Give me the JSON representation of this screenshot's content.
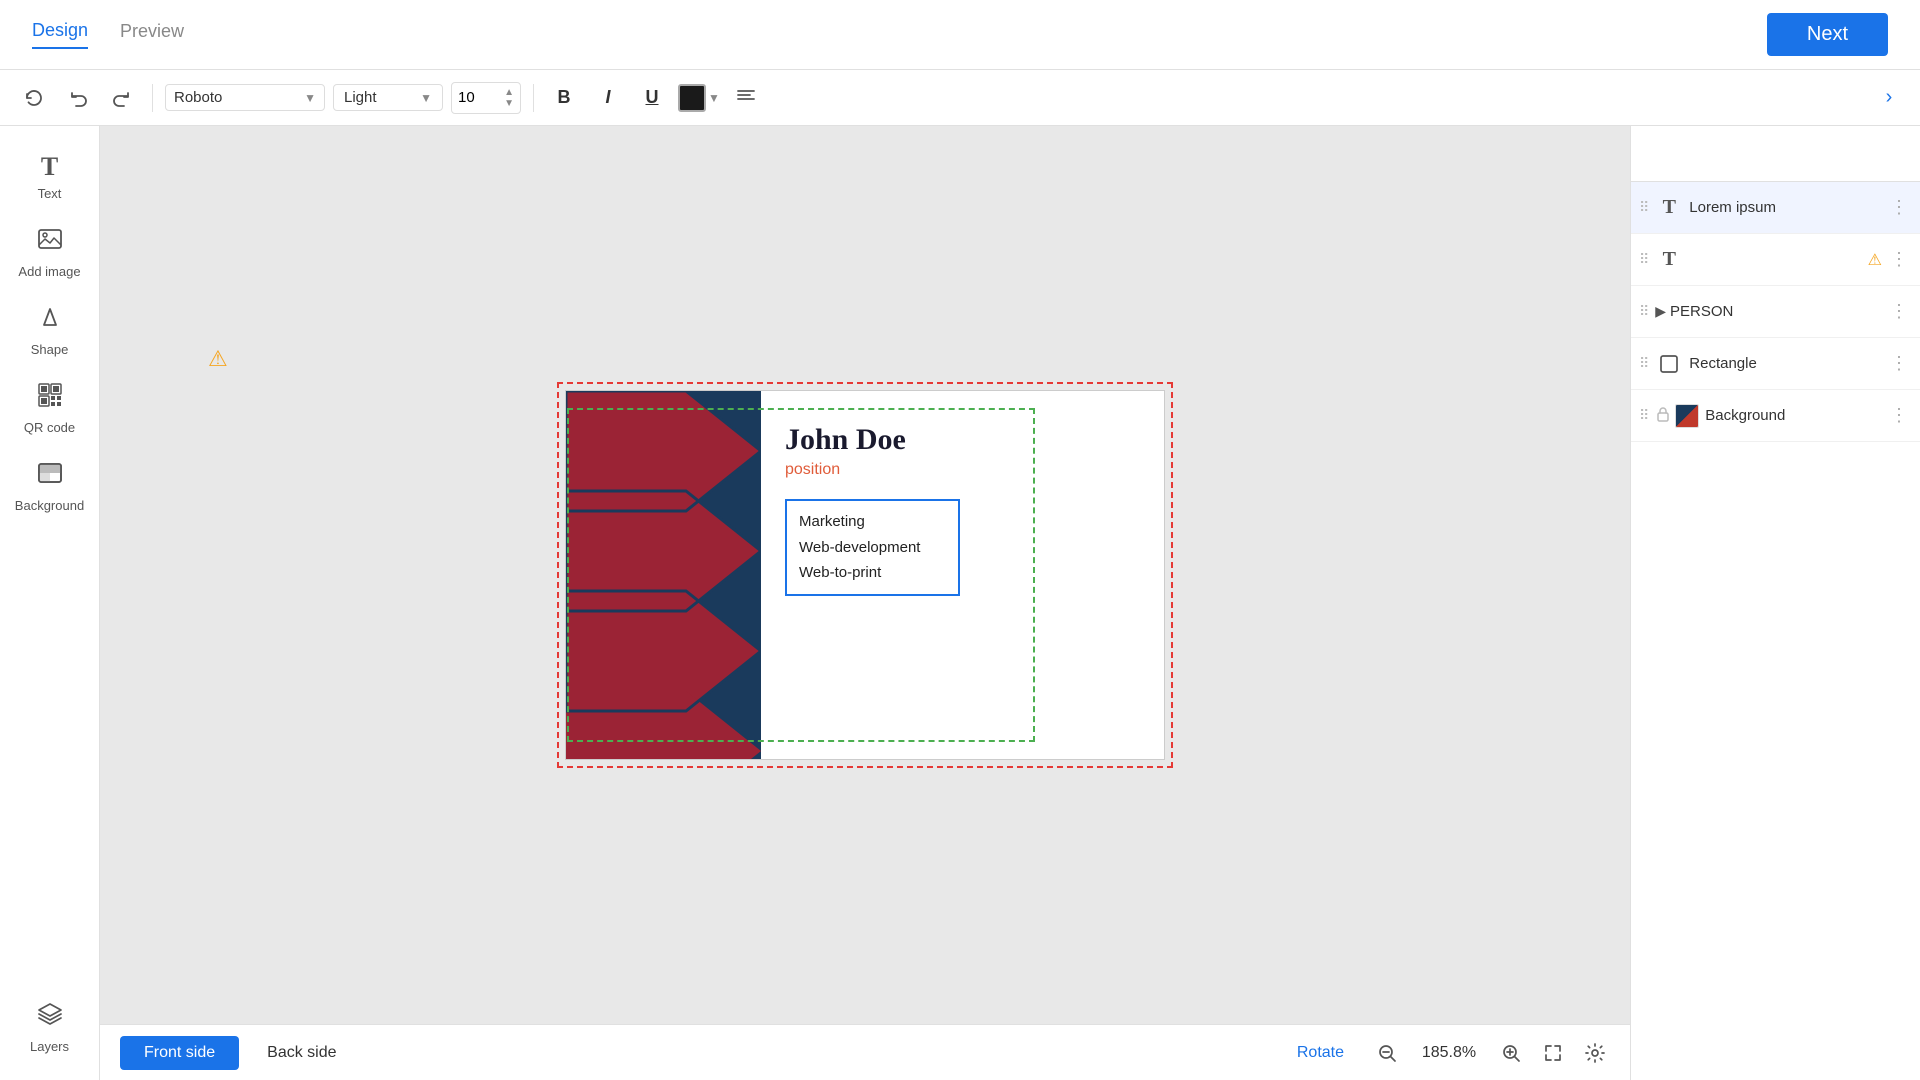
{
  "header": {
    "tabs": [
      {
        "label": "Design",
        "active": true
      },
      {
        "label": "Preview",
        "active": false
      }
    ],
    "next_button": "Next"
  },
  "toolbar": {
    "undo_label": "↩",
    "redo_label": "↪",
    "font_family": "Roboto",
    "font_weight": "Light",
    "font_size": "10",
    "bold_label": "B",
    "italic_label": "I",
    "underline_label": "U",
    "align_label": "≡",
    "chevron_right": "›"
  },
  "sidebar": {
    "items": [
      {
        "label": "Text",
        "icon": "T"
      },
      {
        "label": "Add image",
        "icon": "🖼"
      },
      {
        "label": "Shape",
        "icon": "⬡"
      },
      {
        "label": "QR code",
        "icon": "⊞"
      },
      {
        "label": "Background",
        "icon": "▦"
      }
    ],
    "bottom": {
      "label": "Layers",
      "icon": "⊕"
    }
  },
  "canvas": {
    "card": {
      "name": "John Doe",
      "position": "position",
      "list": [
        "Marketing",
        "Web-development",
        "Web-to-print"
      ]
    }
  },
  "bottom_bar": {
    "front_side": "Front side",
    "back_side": "Back side",
    "rotate": "Rotate",
    "zoom_level": "185.8%"
  },
  "layers": {
    "items": [
      {
        "name": "Lorem ipsum",
        "type": "text",
        "has_warning": false,
        "locked": false,
        "selected": true
      },
      {
        "name": "",
        "type": "text",
        "has_warning": true,
        "locked": false,
        "selected": false
      },
      {
        "name": "PERSON",
        "type": "group",
        "has_warning": false,
        "locked": false,
        "selected": false
      },
      {
        "name": "Rectangle",
        "type": "shape",
        "has_warning": false,
        "locked": false,
        "selected": false
      },
      {
        "name": "Background",
        "type": "background",
        "has_warning": false,
        "locked": true,
        "selected": false
      }
    ]
  }
}
